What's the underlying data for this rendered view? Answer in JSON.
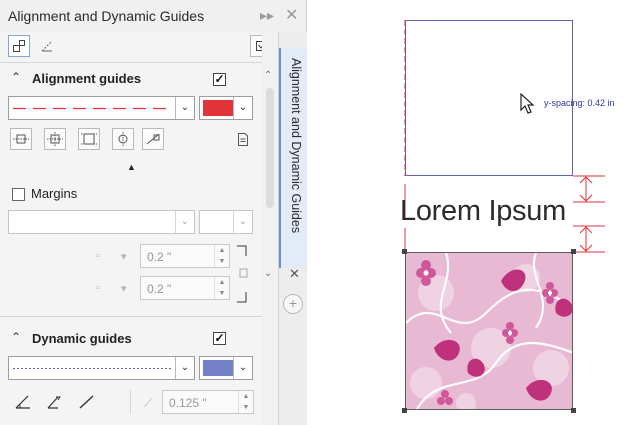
{
  "panel": {
    "title": "Alignment and Dynamic Guides",
    "title_icons": [
      "expand-arrows-icon",
      "close-icon"
    ],
    "vertical_tab_label": "Alignment and Dynamic Guides"
  },
  "alignment": {
    "title": "Alignment guides",
    "enabled": true,
    "line_style": "dashed",
    "line_color": "#e2333a"
  },
  "margins": {
    "label": "Margins",
    "checked": false,
    "offset_top": "0.2 \"",
    "offset_bottom": "0.2 \""
  },
  "dynamic": {
    "title": "Dynamic guides",
    "enabled": true,
    "line_style": "dotted",
    "line_color": "#7682c8",
    "spacing": "0.125 \""
  },
  "canvas": {
    "text": "Lorem Ipsum",
    "spacing_readout": "y-spacing: 0.42 in",
    "guide_color": "#e2333a",
    "frame_color": "#5f62ad"
  }
}
